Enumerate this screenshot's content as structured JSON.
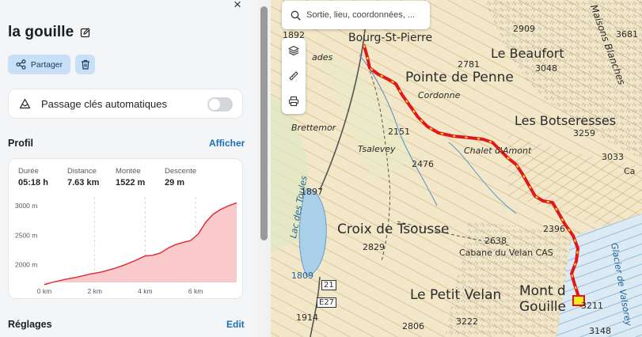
{
  "header": {
    "close_glyph": "×"
  },
  "route": {
    "title": "la gouille"
  },
  "actions": {
    "share_label": "Partager"
  },
  "keys": {
    "label": "Passage clés automatiques",
    "enabled": false
  },
  "profile": {
    "heading": "Profil",
    "show_label": "Afficher",
    "stats": [
      {
        "label": "Durée",
        "value": "05:18 h"
      },
      {
        "label": "Distance",
        "value": "7.63 km"
      },
      {
        "label": "Montée",
        "value": "1522 m"
      },
      {
        "label": "Descente",
        "value": "29 m"
      }
    ]
  },
  "chart_data": {
    "type": "area",
    "title": "",
    "xlabel": "",
    "ylabel": "",
    "x_ticks": [
      "0 km",
      "2 km",
      "4 km",
      "6 km"
    ],
    "y_ticks": [
      "2000 m",
      "2500 m",
      "3000 m"
    ],
    "xlim": [
      0,
      7.63
    ],
    "ylim": [
      1700,
      3150
    ],
    "series": [
      {
        "x": [
          0,
          0.3,
          0.8,
          1.3,
          1.8,
          2.3,
          2.8,
          3.2,
          3.6,
          4.0,
          4.3,
          4.6,
          4.9,
          5.2,
          5.5,
          5.8,
          6.1,
          6.4,
          6.7,
          7.0,
          7.3,
          7.63
        ],
        "y": [
          1660,
          1700,
          1750,
          1790,
          1840,
          1880,
          1940,
          2000,
          2070,
          2150,
          2160,
          2200,
          2280,
          2340,
          2380,
          2410,
          2520,
          2720,
          2860,
          2940,
          3000,
          3050
        ]
      }
    ],
    "line_color": "#e0262f",
    "fill_color": "#f9c9cb",
    "grid": "vertical-dashed"
  },
  "settings": {
    "heading": "Réglages",
    "edit_label": "Edit"
  },
  "map": {
    "search_placeholder": "Sortie, lieu, coordonnées, ...",
    "tools": [
      "layers-icon",
      "ruler-icon",
      "print-icon"
    ],
    "labels": {
      "bourg": "Bourg-St-Pierre",
      "beaufort": "Le Beaufort",
      "penne": "Pointe de Penne",
      "cordonne": "Cordonne",
      "botseresses": "Les Botseresses",
      "brettemor": "Brettemor",
      "tsalevey": "Tsalevey",
      "chalet": "Chalet d'Amont",
      "croix": "Croix de Tsousse",
      "cabane": "Cabane du Velan CAS",
      "petitvelan": "Le Petit Velan",
      "montgouille1": "Mont d",
      "montgouille2": "Gouille",
      "lac": "Lac des Toules",
      "glacier": "Glacier de Valsorey",
      "mulets": "Maisons Blanches",
      "ades": "ades"
    },
    "heights": {
      "h1892": "1892",
      "h2909": "2909",
      "h3681": "3681",
      "h2781": "2781",
      "h3048": "3048",
      "h2151": "2151",
      "h2476": "2476",
      "h3259": "3259",
      "h3033": "3033",
      "h1897": "1897",
      "h2396": "2396",
      "h2638": "2638",
      "h2829": "2829",
      "h21": "21",
      "hE27": "E27",
      "h1914": "1914",
      "h2806": "2806",
      "h3222": "3222",
      "h3211": "3211",
      "h3148": "3148",
      "h1809": "1809",
      "hCa": "Ca"
    }
  }
}
